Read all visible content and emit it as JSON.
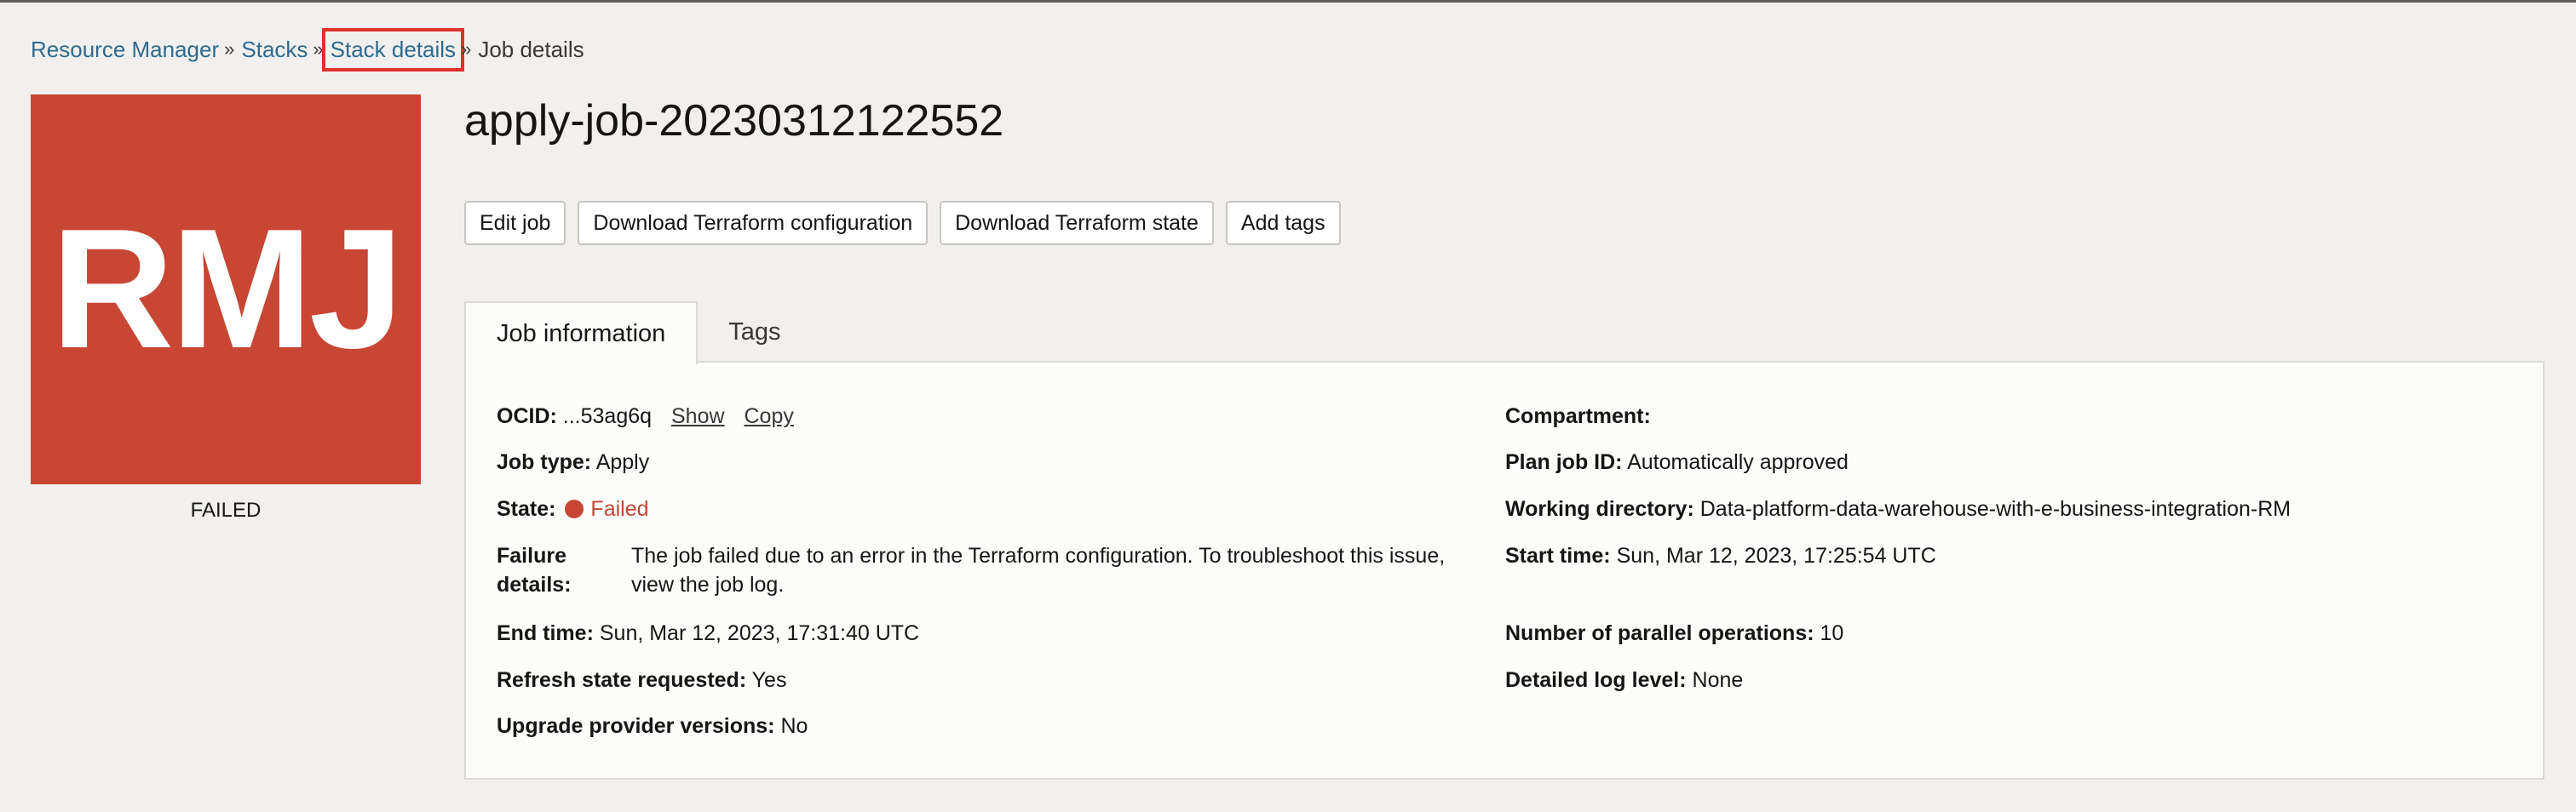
{
  "breadcrumb": {
    "items": [
      "Resource Manager",
      "Stacks",
      "Stack details"
    ],
    "current": "Job details",
    "separator": "»"
  },
  "badge": {
    "text": "RMJ",
    "state": "FAILED",
    "color": "#c74634"
  },
  "title": "apply-job-20230312122552",
  "actions": [
    "Edit job",
    "Download Terraform configuration",
    "Download Terraform state",
    "Add tags"
  ],
  "tabs": [
    "Job information",
    "Tags"
  ],
  "info": {
    "ocid": {
      "label": "OCID:",
      "value": "...53ag6q",
      "show": "Show",
      "copy": "Copy"
    },
    "job_type": {
      "label": "Job type:",
      "value": "Apply"
    },
    "state": {
      "label": "State:",
      "value": "Failed"
    },
    "failure": {
      "label": "Failure details:",
      "value": "The job failed due to an error in the Terraform configuration. To troubleshoot this issue, view the job log."
    },
    "end_time": {
      "label": "End time:",
      "value": "Sun, Mar 12, 2023, 17:31:40 UTC"
    },
    "refresh": {
      "label": "Refresh state requested:",
      "value": "Yes"
    },
    "upgrade": {
      "label": "Upgrade provider versions:",
      "value": "No"
    },
    "compartment": {
      "label": "Compartment:",
      "value": ""
    },
    "plan_job": {
      "label": "Plan job ID:",
      "value": "Automatically approved"
    },
    "working_dir": {
      "label": "Working directory:",
      "value": "Data-platform-data-warehouse-with-e-business-integration-RM"
    },
    "start_time": {
      "label": "Start time:",
      "value": "Sun, Mar 12, 2023, 17:25:54 UTC"
    },
    "parallel": {
      "label": "Number of parallel operations:",
      "value": "10"
    },
    "log_level": {
      "label": "Detailed log level:",
      "value": "None"
    }
  }
}
